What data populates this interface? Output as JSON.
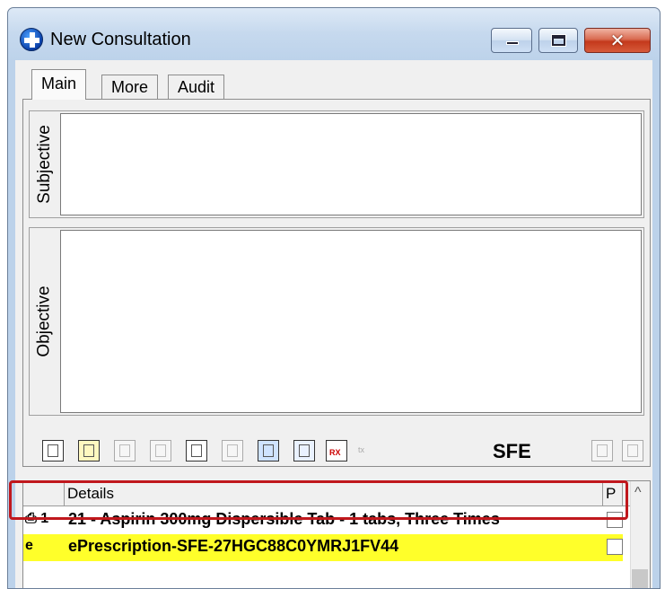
{
  "window": {
    "title": "New Consultation"
  },
  "tabs": [
    {
      "label": "Main",
      "active": true
    },
    {
      "label": "More",
      "active": false
    },
    {
      "label": "Audit",
      "active": false
    }
  ],
  "sections": {
    "subjective_label": "Subjective",
    "objective_label": "Objective"
  },
  "toolbar": {
    "small_label": "tx",
    "badge": "SFE"
  },
  "grid": {
    "columns": {
      "details": "Details",
      "p": "P"
    },
    "rows": [
      {
        "indicator": "⎙ 1",
        "details": "21 - Aspirin 300mg Dispersible Tab - 1 tabs, Three Times",
        "checked": false,
        "highlight": false
      },
      {
        "indicator": "e",
        "details": "ePrescription-SFE-27HGC88C0YMRJ1FV44",
        "checked": false,
        "highlight": true
      }
    ]
  },
  "colors": {
    "highlight_row": "#ffff2a",
    "annotation_border": "#c0181d",
    "close_button": "#c4391c"
  }
}
